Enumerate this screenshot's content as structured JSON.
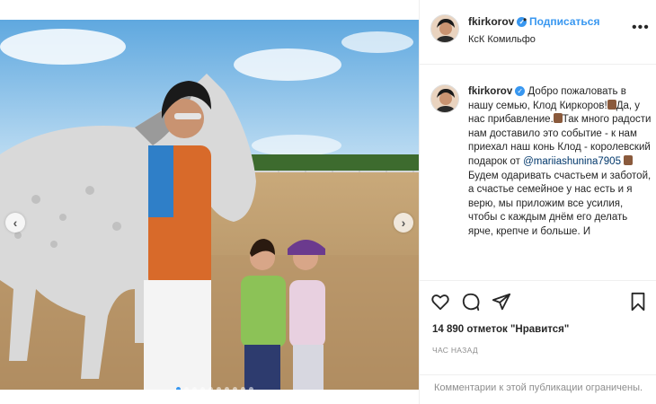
{
  "post": {
    "username": "fkirkorov",
    "separator": "•",
    "follow_label": "Подписаться",
    "location": "КсК Комильфо",
    "more_icon": "more-horizontal-icon",
    "verified_icon": "verified-badge-icon",
    "photo": {
      "prev_icon": "chevron-left-icon",
      "next_icon": "chevron-right-icon",
      "prev_glyph": "‹",
      "next_glyph": "›",
      "carousel_count": 10,
      "carousel_active": 1
    },
    "caption": {
      "username": "fkirkorov",
      "part1": " Добро пожаловать в нашу семью, Клод Киркоров!",
      "part2": "Да, у нас прибавление.",
      "part3": "Так много радости нам доставило это событие - к нам приехал наш конь Клод - королевский подарок от ",
      "mention": "@mariiashunina7905",
      "part4": "Будем одаривать счастьем и заботой, а счастье семейное у нас есть и я верю, мы приложим все усилия, чтобы с каждым днём его делать ярче, крепче и больше. И"
    },
    "actions": {
      "like_icon": "heart-icon",
      "comment_icon": "comment-icon",
      "share_icon": "share-icon",
      "save_icon": "bookmark-icon"
    },
    "likes_text": "14 890 отметок \"Нравится\"",
    "time_text": "ЧАС НАЗАД",
    "comments_disabled": "Комментарии к этой публикации ограничены."
  },
  "colors": {
    "link_blue": "#3897f0",
    "text": "#262626",
    "muted": "#8e8e8e",
    "border": "#efefef",
    "mention": "#00376b"
  }
}
